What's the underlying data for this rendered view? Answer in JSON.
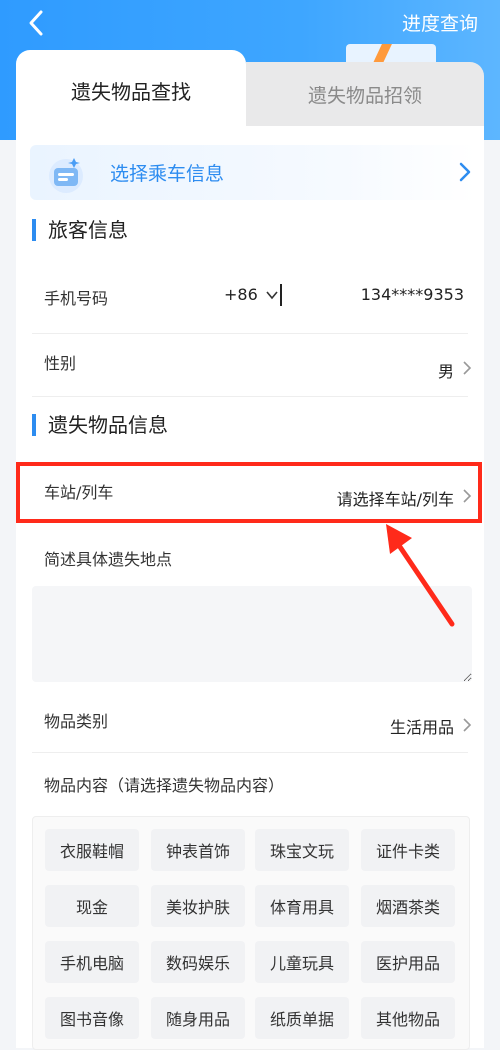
{
  "header": {
    "progress_query": "进度查询"
  },
  "tabs": [
    {
      "label": "遗失物品查找",
      "active": true
    },
    {
      "label": "遗失物品招领",
      "active": false
    }
  ],
  "trip_banner": {
    "label": "选择乘车信息"
  },
  "passenger_section": {
    "title": "旅客信息",
    "phone": {
      "label": "手机号码",
      "country_code": "+86",
      "value": "134****9353"
    },
    "gender": {
      "label": "性别",
      "value": "男"
    }
  },
  "item_section": {
    "title": "遗失物品信息",
    "station": {
      "label": "车站/列车",
      "placeholder": "请选择车站/列车"
    },
    "location": {
      "label": "简述具体遗失地点",
      "value": ""
    },
    "category": {
      "label": "物品类别",
      "value": "生活用品"
    },
    "content_label": "物品内容（请选择遗失物品内容）",
    "tags": [
      "衣服鞋帽",
      "钟表首饰",
      "珠宝文玩",
      "证件卡类",
      "现金",
      "美妆护肤",
      "体育用具",
      "烟酒茶类",
      "手机电脑",
      "数码娱乐",
      "儿童玩具",
      "医护用品",
      "图书音像",
      "随身用品",
      "纸质单据",
      "其他物品"
    ]
  },
  "colors": {
    "accent": "#2d8cf0",
    "highlight": "#ff2a1a",
    "header": "#3ea6ff"
  }
}
